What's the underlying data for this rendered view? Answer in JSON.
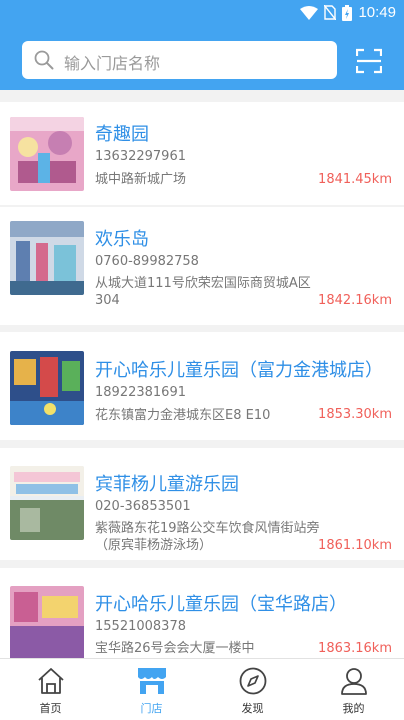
{
  "status_bar": {
    "time": "10:49"
  },
  "search": {
    "placeholder": "输入门店名称"
  },
  "stores": [
    {
      "name": "奇趣园",
      "phone": "13632297961",
      "address": "城中路新城广场",
      "distance": "1841.45km"
    },
    {
      "name": "欢乐岛",
      "phone": "0760-89982758",
      "address": "从城大道111号欣荣宏国际商贸城A区304",
      "distance": "1842.16km"
    },
    {
      "name": "开心哈乐儿童乐园（富力金港城店）",
      "phone": "18922381691",
      "address": "花东镇富力金港城东区E8 E10",
      "distance": "1853.30km"
    },
    {
      "name": "宾菲杨儿童游乐园",
      "phone": "020-36853501",
      "address": "紫薇路东花19路公交车饮食风情街站旁（原宾菲杨游泳场）",
      "distance": "1861.10km"
    },
    {
      "name": "开心哈乐儿童乐园（宝华路店）",
      "phone": "15521008378",
      "address": "宝华路26号会会大厦一楼中",
      "distance": "1863.16km"
    }
  ],
  "tabs": [
    {
      "label": "首页",
      "icon": "home-icon"
    },
    {
      "label": "门店",
      "icon": "store-icon"
    },
    {
      "label": "发现",
      "icon": "compass-icon"
    },
    {
      "label": "我的",
      "icon": "user-icon"
    }
  ],
  "colors": {
    "primary": "#43a4f1",
    "store_name": "#2f8fe6",
    "distance": "#f0605a"
  }
}
